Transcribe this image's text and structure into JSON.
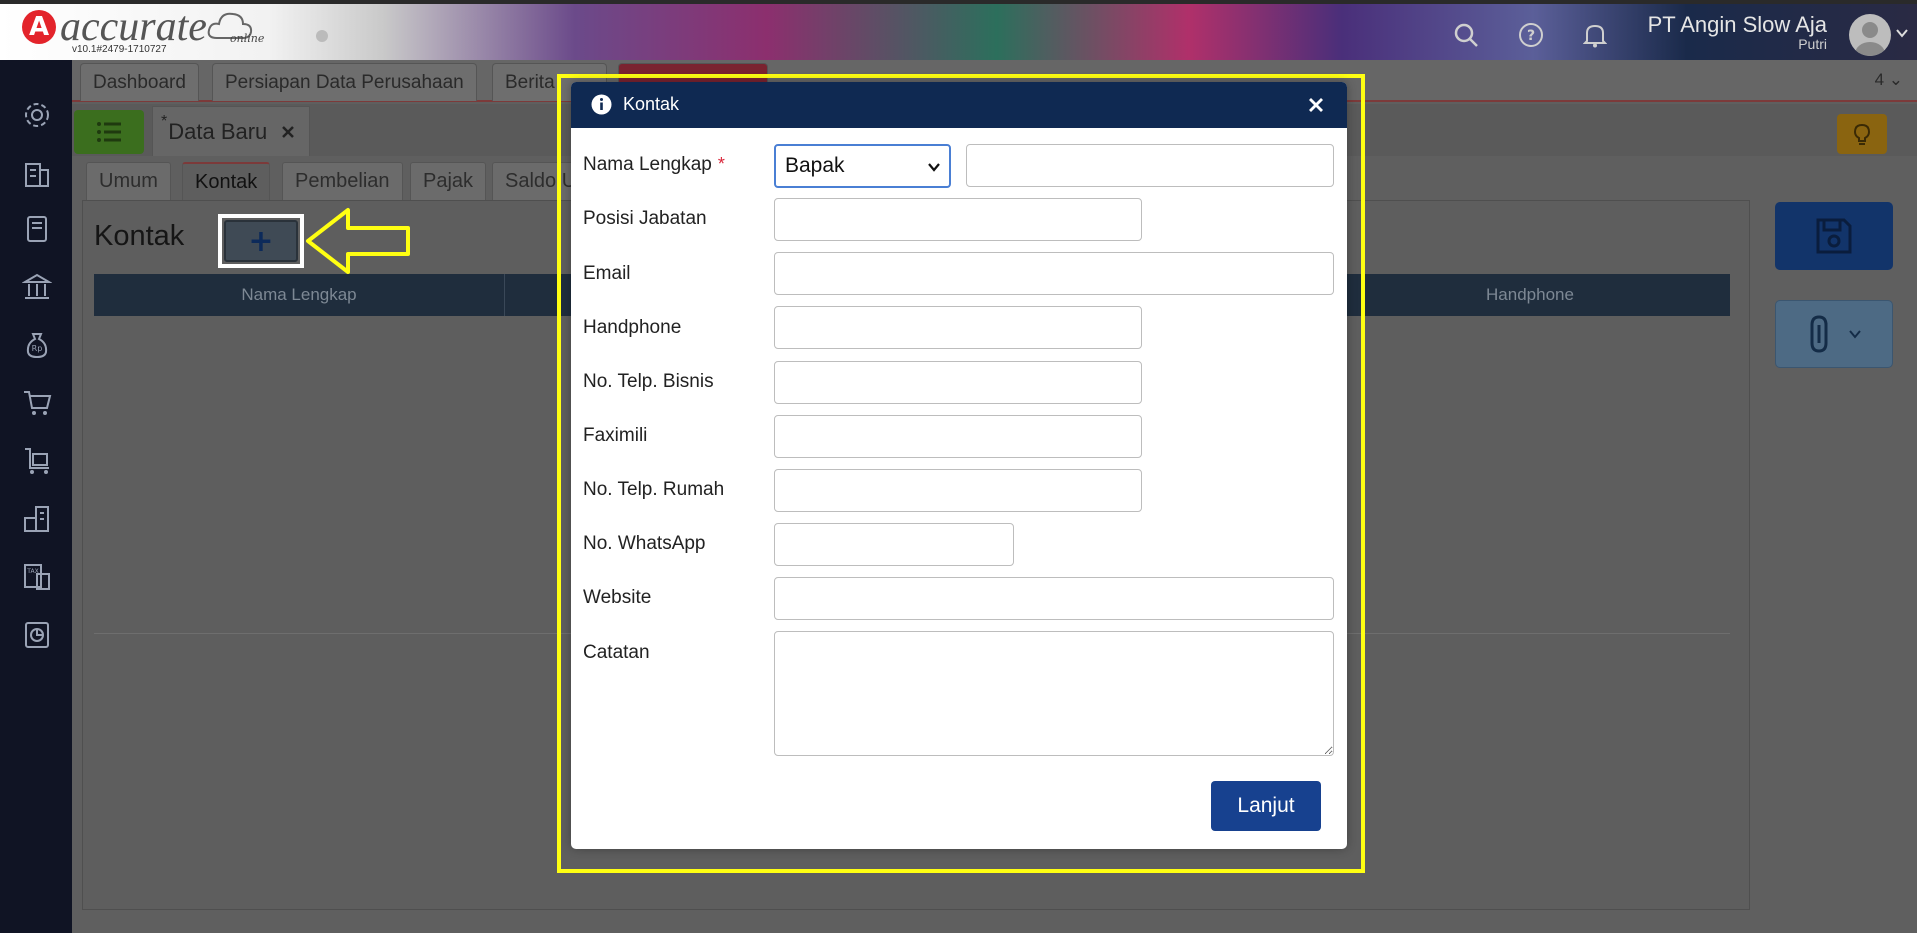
{
  "header": {
    "brand_logo": "accurate",
    "brand_sub": "online",
    "version": "v10.1#2479-1710727",
    "company_name": "PT Angin Slow Aja",
    "user_name": "Putri",
    "icons": [
      "search-icon",
      "help-icon",
      "bell-icon"
    ]
  },
  "sidebar": {
    "icons": [
      "gear-icon",
      "building-icon",
      "book-icon",
      "bank-icon",
      "money-bag-icon",
      "cart-icon",
      "trolley-icon",
      "warehouse-icon",
      "tax-icon",
      "report-icon"
    ]
  },
  "tabs": {
    "items": [
      "Dashboard",
      "Persiapan Data Perusahaan",
      "Berita",
      ""
    ],
    "count": "4"
  },
  "doc_tab": {
    "star": "*",
    "label": "Data Baru"
  },
  "form_tabs": [
    "Umum",
    "Kontak",
    "Pembelian",
    "Pajak",
    "Saldo U"
  ],
  "section": {
    "title": "Kontak",
    "add_label": "+"
  },
  "table": {
    "columns": [
      "Nama Lengkap",
      "Handphone"
    ]
  },
  "modal": {
    "title": "Kontak",
    "close_label": "×",
    "fields": {
      "nama_lengkap": {
        "label": "Nama Lengkap",
        "required": "*",
        "salutation": "Bapak",
        "value": ""
      },
      "posisi_jabatan": {
        "label": "Posisi Jabatan",
        "value": ""
      },
      "email": {
        "label": "Email",
        "value": ""
      },
      "handphone": {
        "label": "Handphone",
        "value": ""
      },
      "telp_bisnis": {
        "label": "No. Telp. Bisnis",
        "value": ""
      },
      "faximili": {
        "label": "Faximili",
        "value": ""
      },
      "telp_rumah": {
        "label": "No. Telp. Rumah",
        "value": ""
      },
      "whatsapp": {
        "label": "No. WhatsApp",
        "value": ""
      },
      "website": {
        "label": "Website",
        "value": ""
      },
      "catatan": {
        "label": "Catatan",
        "value": ""
      }
    },
    "submit_label": "Lanjut"
  },
  "colors": {
    "modal_header": "#0f2952",
    "primary_button": "#17418f",
    "highlight": "#ffff12",
    "required": "#d9263a",
    "sidebar": "#101424"
  }
}
